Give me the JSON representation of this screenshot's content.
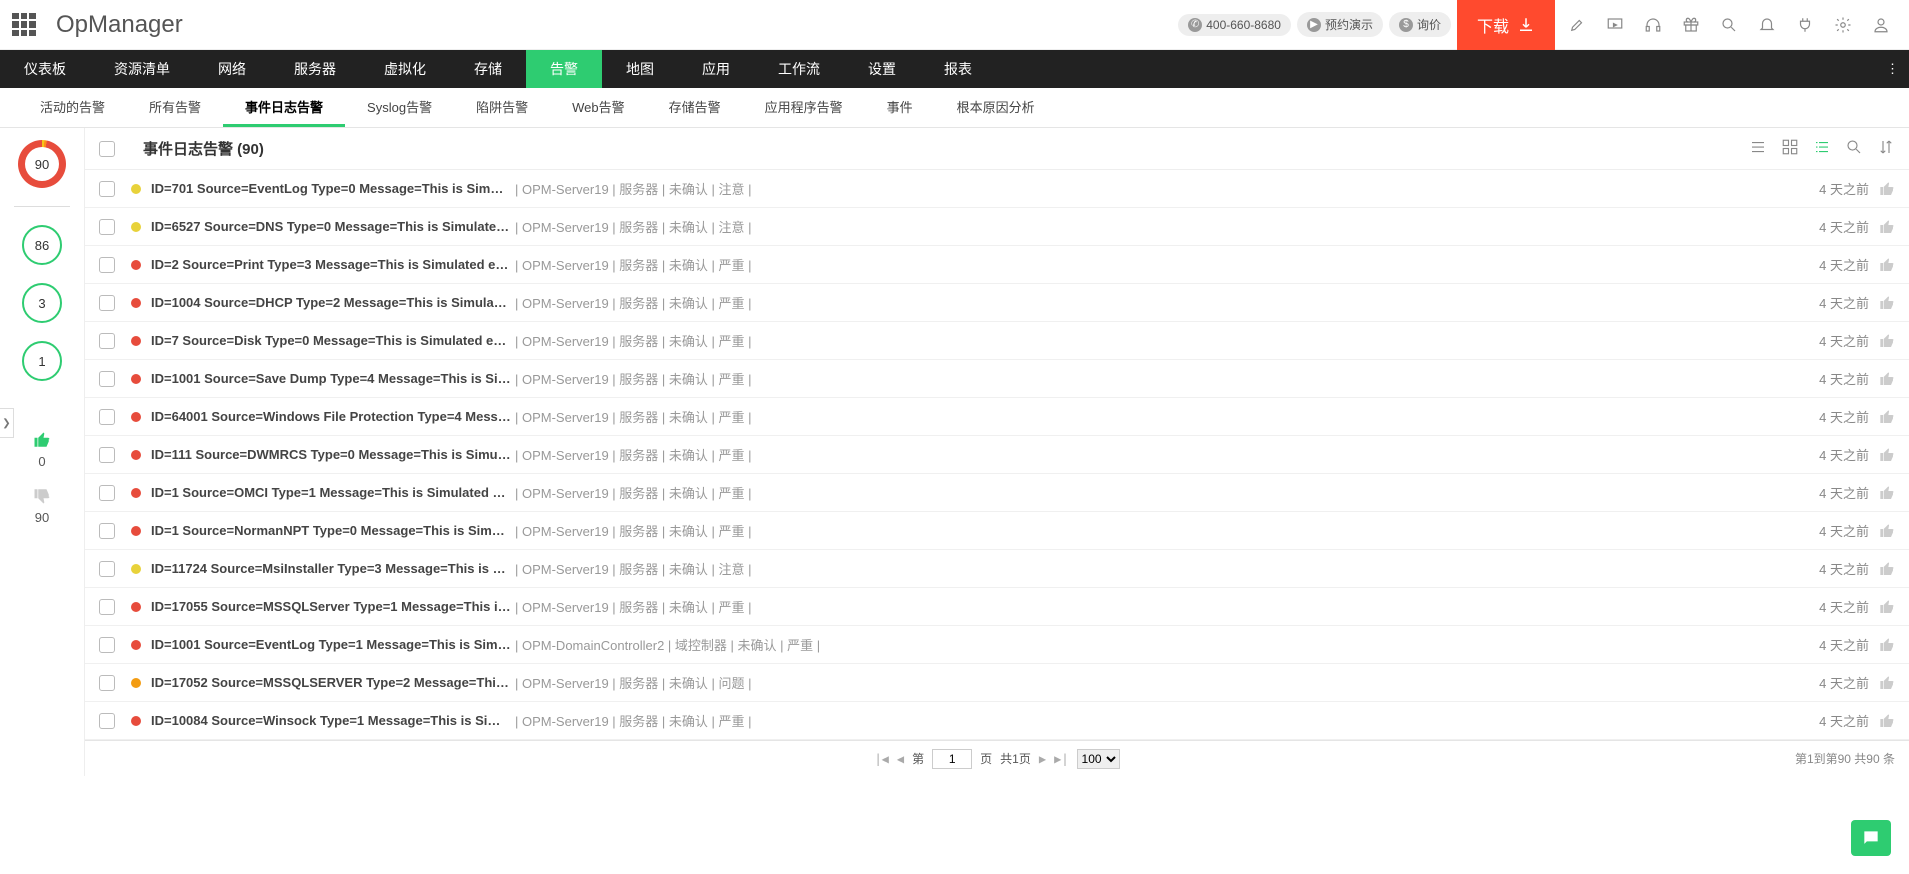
{
  "header": {
    "brand": "OpManager",
    "phone": "400-660-8680",
    "demo": "预约演示",
    "quote": "询价",
    "download": "下载"
  },
  "mainnav": {
    "items": [
      "仪表板",
      "资源清单",
      "网络",
      "服务器",
      "虚拟化",
      "存储",
      "告警",
      "地图",
      "应用",
      "工作流",
      "设置",
      "报表"
    ],
    "active_index": 6
  },
  "subnav": {
    "items": [
      "活动的告警",
      "所有告警",
      "事件日志告警",
      "Syslog告警",
      "陷阱告警",
      "Web告警",
      "存储告警",
      "应用程序告警",
      "事件",
      "根本原因分析"
    ],
    "active_index": 2
  },
  "sidebar": {
    "total": "90",
    "counts": [
      "86",
      "3",
      "1"
    ],
    "up": "0",
    "down": "90"
  },
  "list": {
    "title": "事件日志告警 (90)",
    "rows": [
      {
        "sev": "yellow",
        "msg": "ID=701 Source=EventLog Type=0 Message=This is Simulat...",
        "server": "OPM-Server19",
        "cat": "服务器",
        "ack": "未确认",
        "lvl": "注意",
        "time": "4 天之前"
      },
      {
        "sev": "yellow",
        "msg": "ID=6527 Source=DNS Type=0 Message=This is Simulated ...",
        "server": "OPM-Server19",
        "cat": "服务器",
        "ack": "未确认",
        "lvl": "注意",
        "time": "4 天之前"
      },
      {
        "sev": "red",
        "msg": "ID=2 Source=Print Type=3 Message=This is Simulated eve...",
        "server": "OPM-Server19",
        "cat": "服务器",
        "ack": "未确认",
        "lvl": "严重",
        "time": "4 天之前"
      },
      {
        "sev": "red",
        "msg": "ID=1004 Source=DHCP Type=2 Message=This is Simulate...",
        "server": "OPM-Server19",
        "cat": "服务器",
        "ack": "未确认",
        "lvl": "严重",
        "time": "4 天之前"
      },
      {
        "sev": "red",
        "msg": "ID=7 Source=Disk Type=0 Message=This is Simulated even...",
        "server": "OPM-Server19",
        "cat": "服务器",
        "ack": "未确认",
        "lvl": "严重",
        "time": "4 天之前"
      },
      {
        "sev": "red",
        "msg": "ID=1001 Source=Save Dump Type=4 Message=This is Sim...",
        "server": "OPM-Server19",
        "cat": "服务器",
        "ack": "未确认",
        "lvl": "严重",
        "time": "4 天之前"
      },
      {
        "sev": "red",
        "msg": "ID=64001 Source=Windows File Protection Type=4 Messa...",
        "server": "OPM-Server19",
        "cat": "服务器",
        "ack": "未确认",
        "lvl": "严重",
        "time": "4 天之前"
      },
      {
        "sev": "red",
        "msg": "ID=111 Source=DWMRCS Type=0 Message=This is Simula...",
        "server": "OPM-Server19",
        "cat": "服务器",
        "ack": "未确认",
        "lvl": "严重",
        "time": "4 天之前"
      },
      {
        "sev": "red",
        "msg": "ID=1 Source=OMCI Type=1 Message=This is Simulated ev...",
        "server": "OPM-Server19",
        "cat": "服务器",
        "ack": "未确认",
        "lvl": "严重",
        "time": "4 天之前"
      },
      {
        "sev": "red",
        "msg": "ID=1 Source=NormanNPT Type=0 Message=This is Simula...",
        "server": "OPM-Server19",
        "cat": "服务器",
        "ack": "未确认",
        "lvl": "严重",
        "time": "4 天之前"
      },
      {
        "sev": "yellow",
        "msg": "ID=11724 Source=MsiInstaller Type=3 Message=This is Si...",
        "server": "OPM-Server19",
        "cat": "服务器",
        "ack": "未确认",
        "lvl": "注意",
        "time": "4 天之前"
      },
      {
        "sev": "red",
        "msg": "ID=17055 Source=MSSQLServer Type=1 Message=This is ...",
        "server": "OPM-Server19",
        "cat": "服务器",
        "ack": "未确认",
        "lvl": "严重",
        "time": "4 天之前"
      },
      {
        "sev": "red",
        "msg": "ID=1001 Source=EventLog Type=1 Message=This is Simula...",
        "server": "OPM-DomainController2",
        "cat": "域控制器",
        "ack": "未确认",
        "lvl": "严重",
        "time": "4 天之前"
      },
      {
        "sev": "orange",
        "msg": "ID=17052 Source=MSSQLSERVER Type=2 Message=This i...",
        "server": "OPM-Server19",
        "cat": "服务器",
        "ack": "未确认",
        "lvl": "问题",
        "time": "4 天之前"
      },
      {
        "sev": "red",
        "msg": "ID=10084 Source=Winsock Type=1 Message=This is Simul...",
        "server": "OPM-Server19",
        "cat": "服务器",
        "ack": "未确认",
        "lvl": "严重",
        "time": "4 天之前"
      }
    ]
  },
  "pager": {
    "label_page_prefix": "第",
    "current": "1",
    "label_page_suffix": "页",
    "total_pages": "共1页",
    "page_size": "100",
    "totals": "第1到第90 共90 条"
  }
}
